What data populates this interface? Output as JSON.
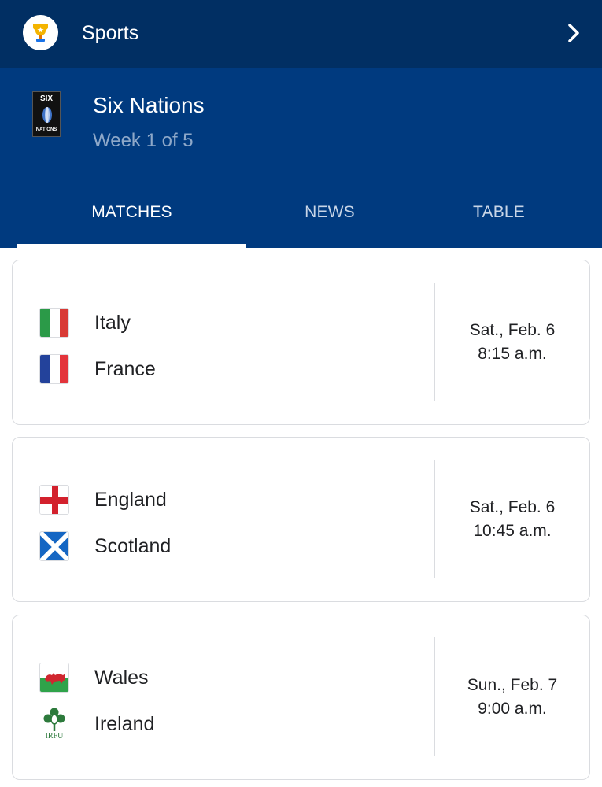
{
  "app": {
    "section_title": "Sports",
    "icons": {
      "section": "trophy-icon",
      "navigate": "chevron-right-icon"
    }
  },
  "league": {
    "name": "Six Nations",
    "week": "Week 1 of 5",
    "logo_text_top": "SIX",
    "logo_text_bottom": "NATIONS"
  },
  "tabs": [
    {
      "label": "MATCHES",
      "active": true
    },
    {
      "label": "NEWS",
      "active": false
    },
    {
      "label": "TABLE",
      "active": false
    }
  ],
  "matches": [
    {
      "home": {
        "name": "Italy",
        "flag": "italy-flag-icon"
      },
      "away": {
        "name": "France",
        "flag": "france-flag-icon"
      },
      "date": "Sat., Feb. 6",
      "time": "8:15 a.m."
    },
    {
      "home": {
        "name": "England",
        "flag": "england-flag-icon"
      },
      "away": {
        "name": "Scotland",
        "flag": "scotland-flag-icon"
      },
      "date": "Sat., Feb. 6",
      "time": "10:45 a.m."
    },
    {
      "home": {
        "name": "Wales",
        "flag": "wales-flag-icon"
      },
      "away": {
        "name": "Ireland",
        "flag": "irfu-logo-icon",
        "logo_text": "IRFU"
      },
      "date": "Sun., Feb. 7",
      "time": "9:00 a.m."
    }
  ],
  "colors": {
    "topbar": "#012f63",
    "league_header": "#003a7f",
    "subtitle": "#8ea8c9",
    "card_border": "#dadce0"
  }
}
